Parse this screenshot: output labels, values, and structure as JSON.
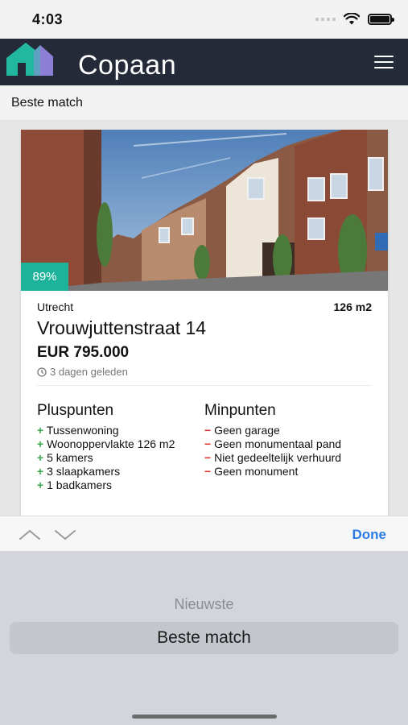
{
  "status_bar": {
    "time": "4:03"
  },
  "app": {
    "title": "Copaan"
  },
  "sort": {
    "current": "Beste match"
  },
  "listing": {
    "match": "89%",
    "city": "Utrecht",
    "size": "126 m2",
    "address": "Vrouwjuttenstraat 14",
    "price": "EUR 795.000",
    "posted": "3 dagen geleden",
    "pros_title": "Pluspunten",
    "cons_title": "Minpunten",
    "pros": [
      "Tussenwoning",
      "Woonoppervlakte 126 m2",
      "5 kamers",
      "3 slaapkamers",
      "1 badkamers"
    ],
    "cons": [
      "Geen garage",
      "Geen monumentaal pand",
      "Niet gedeeltelijk verhuurd",
      "Geen monument"
    ]
  },
  "toolbar": {
    "done_label": "Done"
  },
  "picker": {
    "options": [
      "Nieuwste",
      "Beste match"
    ],
    "selected": "Beste match"
  },
  "colors": {
    "header": "#242a37",
    "accent": "#1cb39a",
    "plus": "#3aa74b",
    "minus": "#e0312a",
    "done": "#2c7be5"
  }
}
